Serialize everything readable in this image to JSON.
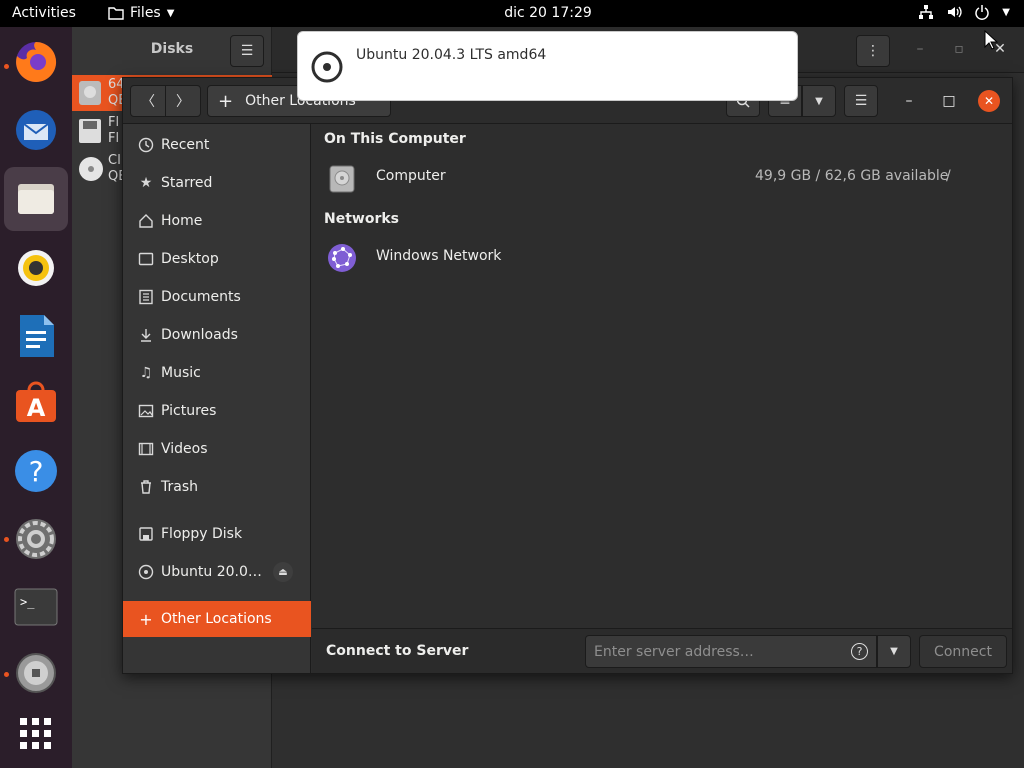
{
  "topbar": {
    "activities": "Activities",
    "app_menu": "Files",
    "clock": "dic 20  17:29"
  },
  "notification": {
    "text": "Ubuntu 20.04.3 LTS amd64"
  },
  "disks": {
    "title": "Disks",
    "items": [
      {
        "line1": "64",
        "line2": "QE"
      },
      {
        "line1": "Fl",
        "line2": "Fl"
      },
      {
        "line1": "CI",
        "line2": "QE"
      }
    ]
  },
  "files": {
    "path_label": "Other Locations",
    "sidebar": [
      {
        "label": "Recent",
        "icon": "clock-icon"
      },
      {
        "label": "Starred",
        "icon": "star-icon"
      },
      {
        "label": "Home",
        "icon": "home-icon"
      },
      {
        "label": "Desktop",
        "icon": "desktop-icon"
      },
      {
        "label": "Documents",
        "icon": "document-icon"
      },
      {
        "label": "Downloads",
        "icon": "download-icon"
      },
      {
        "label": "Music",
        "icon": "music-icon"
      },
      {
        "label": "Pictures",
        "icon": "picture-icon"
      },
      {
        "label": "Videos",
        "icon": "video-icon"
      },
      {
        "label": "Trash",
        "icon": "trash-icon"
      },
      {
        "label": "Floppy Disk",
        "icon": "floppy-icon"
      },
      {
        "label": "Ubuntu 20.0…",
        "icon": "disc-icon"
      },
      {
        "label": "Other Locations",
        "icon": "plus-icon"
      }
    ],
    "on_this_computer": "On This Computer",
    "computer": {
      "name": "Computer",
      "usage": "49,9 GB / 62,6 GB available",
      "mount": "/"
    },
    "networks": "Networks",
    "windows_network": "Windows Network",
    "connect_to_server": "Connect to Server",
    "server_placeholder": "Enter server address…",
    "connect_label": "Connect"
  },
  "colors": {
    "accent": "#e95420",
    "dock_bg": "#2b1e2a",
    "panel_bg": "#2d2d2d"
  }
}
